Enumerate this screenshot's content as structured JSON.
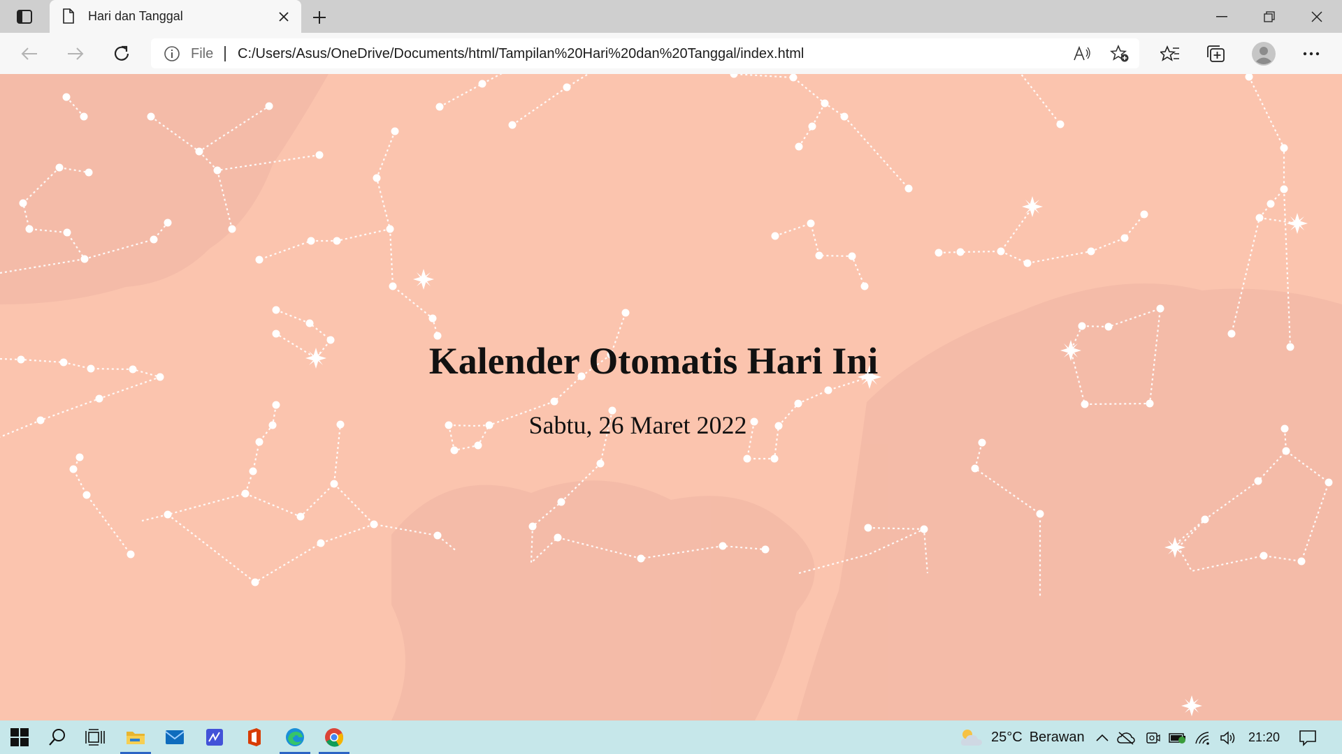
{
  "browser": {
    "tab": {
      "title": "Hari dan Tanggal"
    },
    "address_bar": {
      "scheme_label": "File",
      "url": "C:/Users/Asus/OneDrive/Documents/html/Tampilan%20Hari%20dan%20Tanggal/index.html"
    },
    "icons": {
      "tab_actions": "tab-actions-icon",
      "tab_file": "file-icon",
      "close": "close-icon",
      "new_tab": "plus-icon",
      "back": "back-arrow-icon",
      "forward": "forward-arrow-icon",
      "refresh": "refresh-icon",
      "info": "info-icon",
      "read_aloud": "read-aloud-icon",
      "add_favorite": "add-favorite-icon",
      "favorites": "favorites-icon",
      "collections": "collections-icon",
      "profile": "profile-icon",
      "more": "more-icon"
    }
  },
  "page": {
    "title": "Kalender Otomatis Hari Ini",
    "date": "Sabtu, 26 Maret 2022",
    "colors": {
      "background": "#fbc4ae",
      "clouds": "#f2b8a5",
      "stars": "#ffffff",
      "text": "#111111"
    }
  },
  "taskbar": {
    "weather": {
      "temp": "25°C",
      "condition": "Berawan"
    },
    "clock": "21:20",
    "apps": [
      "start",
      "search",
      "task-view",
      "file-explorer",
      "mail",
      "whiteboard",
      "office",
      "edge",
      "chrome"
    ]
  }
}
